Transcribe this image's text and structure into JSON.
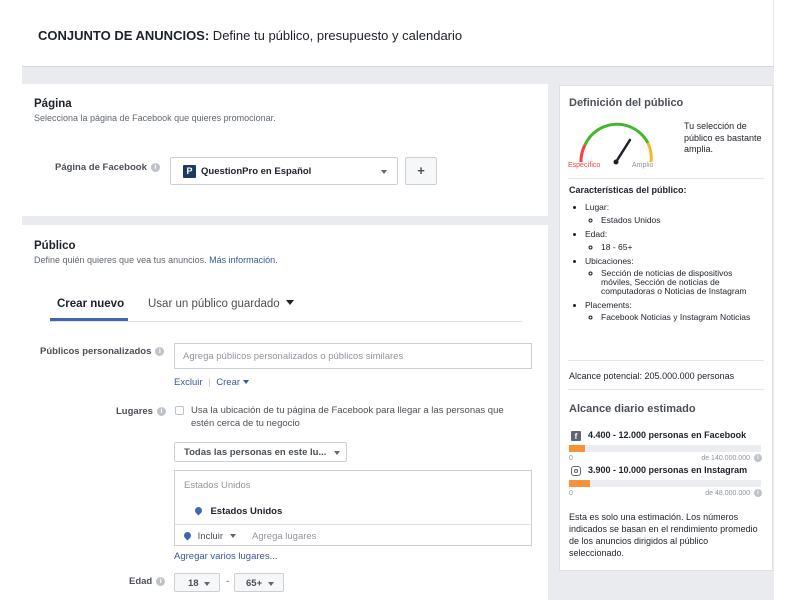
{
  "header": {
    "bold": "CONJUNTO DE ANUNCIOS:",
    "rest": " Define tu público, presupuesto y calendario"
  },
  "pagina": {
    "title": "Página",
    "subtitle": "Selecciona la página de Facebook que quieres promocionar.",
    "field_label": "Página de Facebook",
    "selected_page": "QuestionPro en Español",
    "add_label": "+"
  },
  "publico": {
    "title": "Público",
    "subtitle": "Define quién quieres que vea tus anuncios.",
    "more_info": "Más información.",
    "tabs": [
      {
        "label": "Crear nuevo",
        "active": true
      },
      {
        "label": "Usar un público guardado",
        "active": false
      }
    ]
  },
  "custom_audiences": {
    "label": "Públicos personalizados",
    "placeholder": "Agrega públicos personalizados o públicos similares",
    "exclude": "Excluir",
    "separator": "|",
    "create": "Crear"
  },
  "locations": {
    "label": "Lugares",
    "checkbox_text": "Usa la ubicación de tu página de Facebook para llegar a las personas que estén cerca de tu negocio",
    "people_select": "Todas las personas en este lu...",
    "country_header": "Estados Unidos",
    "country_selected": "Estados Unidos",
    "include": "Incluir",
    "add_placeholder": "Agrega lugares",
    "add_multiple": "Agregar varios lugares..."
  },
  "age": {
    "label": "Edad",
    "min": "18",
    "dash": "-",
    "max": "65+"
  },
  "definition": {
    "title": "Definición del público",
    "gauge_specific": "Específico",
    "gauge_broad": "Amplio",
    "gauge_level": 0.68,
    "summary": "Tu selección de público es bastante amplia.",
    "characteristics_title": "Características del público:",
    "items": [
      {
        "label": "Lugar:",
        "value": "Estados Unidos"
      },
      {
        "label": "Edad:",
        "value": "18 - 65+"
      },
      {
        "label": "Ubicaciones:",
        "value": "Sección de noticias de dispositivos móviles, Sección de noticias de computadoras o Noticias de Instagram"
      },
      {
        "label": "Placements:",
        "value": "Facebook Noticias y Instagram Noticias"
      }
    ],
    "potential_reach": "Alcance potencial: 205.000.000 personas"
  },
  "daily_reach": {
    "title": "Alcance diario estimado",
    "facebook": {
      "label": "4.400 - 12.000 personas en Facebook",
      "min": "0",
      "max": "de 140.000.000",
      "fill_fraction": 0.085
    },
    "instagram": {
      "label": "3.900 - 10.000 personas en Instagram",
      "min": "0",
      "max": "de 48.000.000",
      "fill_fraction": 0.11
    },
    "note": "Esta es solo una estimación. Los números indicados se basan en el rendimiento promedio de los anuncios dirigidos al público seleccionado."
  },
  "colors": {
    "accent": "#4267b2",
    "link": "#365899",
    "bar": "#f7923b",
    "gauge_green": "#42b72a",
    "gauge_red": "#fa3e3e",
    "gauge_yellow": "#f7b928"
  }
}
